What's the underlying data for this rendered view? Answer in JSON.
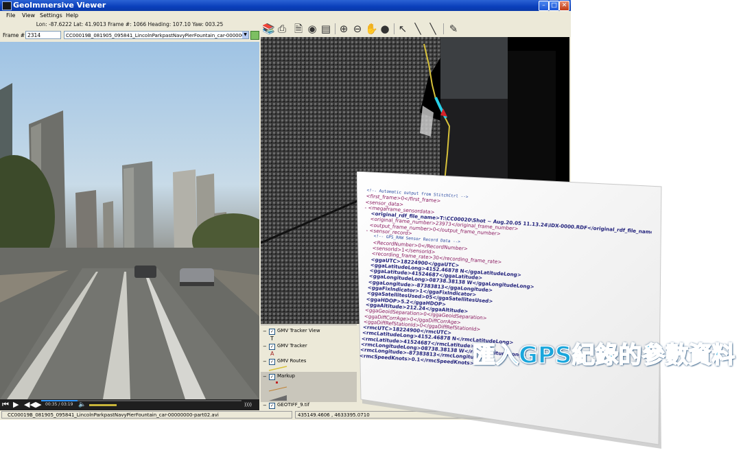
{
  "window": {
    "title": "GeoImmersive Viewer"
  },
  "menu": [
    "File",
    "View",
    "Settings",
    "Help"
  ],
  "status_info": "Lon: -87.6222  Lat: 41.9013  Frame #: 1066  Heading: 107.10  Yaw: 003.25",
  "frame_selector": {
    "label": "Frame #",
    "value": "2314",
    "file": "CC00019B_081905_095841_LincolnParkpastNavyPierFountain_car-00000000-part"
  },
  "toolbar_icons": [
    "open-icon",
    "save-icon",
    "document-icon",
    "globe-icon",
    "list-icon",
    "zoom-in-icon",
    "zoom-out-icon",
    "pan-icon",
    "globe-tool-icon",
    "pointer-icon",
    "measure-icon",
    "ruler-icon",
    "edit-icon"
  ],
  "layers": [
    {
      "name": "GMV Tracker View",
      "checked": true,
      "symbol": "T"
    },
    {
      "name": "GMV Tracker",
      "checked": true,
      "symbol": "A"
    },
    {
      "name": "GMV Routes",
      "checked": true,
      "symbol": "line"
    },
    {
      "name": "Markup",
      "checked": true,
      "symbol": "markup"
    },
    {
      "name": "GEOTIFF_9.tif",
      "checked": true,
      "symbol": ""
    }
  ],
  "playback": {
    "time": "00:35 / 03:19",
    "progress": 0.18
  },
  "statusbar": {
    "file": "CC00019B_081905_095841_LincolnParkpastNavyPierFountain_car-00000000-part02.avi",
    "coords": "435149.4606 , 4633395.0710"
  },
  "xml_lines": [
    "<!-- Automatic output from StitchCtrl -->",
    "<first_frame>0</first_frame>",
    "<sensor_data>",
    "- <megaframe_sensordata>",
    "<original_rdf_file_name>T:\\CC00020\\Shot ~ Aug.20.05 11.13.24\\IDX-0000.RDF</original_rdf_file_name>",
    "<original_frame_number>23973</original_frame_number>",
    "<output_frame_number>0</output_frame_number>",
    "- <sensor_record>",
    "<!-- GPS_RAW Sensor Record Data -->",
    "<RecordNumber>0</RecordNumber>",
    "<sensorId>1</sensorId>",
    "<recording_frame_rate>30</recording_frame_rate>",
    "<ggaUTC>18224900</ggaUTC>",
    "<ggaLatitudeLong>4152.46878 N</ggaLatitudeLong>",
    "<ggaLatitude>41524687</ggaLatitude>",
    "<ggaLongitudeLong>08738.38138 W</ggaLongitudeLong>",
    "<ggaLongitude>-87383813</ggaLongitude>",
    "<ggaFixIndicator>1</ggaFixIndicator>",
    "<ggaSatellitesUsed>05</ggaSatellitesUsed>",
    "<ggaHDOP>5.2</ggaHDOP>",
    "<ggaAltitude>212.24</ggaAltitude>",
    "<ggaGeoidSeparation>0</ggaGeoidSeparation>",
    "<ggaDiffCorrAge>0</ggaDiffCorrAge>",
    "<ggaDiffRefStationId>0</ggaDiffRefStationId>",
    "<rmcUTC>18224900</rmcUTC>",
    "<rmcLatitudeLong>4152.46878 N</rmcLatitudeLong>",
    "<rmcLatitude>41524687</rmcLatitude>",
    "<rmcLongitudeLong>08738.38138 W</rmcLongitudeLong>",
    "<rmcLongitude>-87383813</rmcLongitude>",
    "<rmcSpeedKnots>0.1</rmcSpeedKnots>"
  ],
  "banner": "匯入GPS紀錄的參數資料",
  "colors": {
    "banner": "#1aa6dc",
    "titlebar": "#0a3fbb",
    "route": "#d8c23a",
    "route_highlight": "#28d0e8"
  }
}
